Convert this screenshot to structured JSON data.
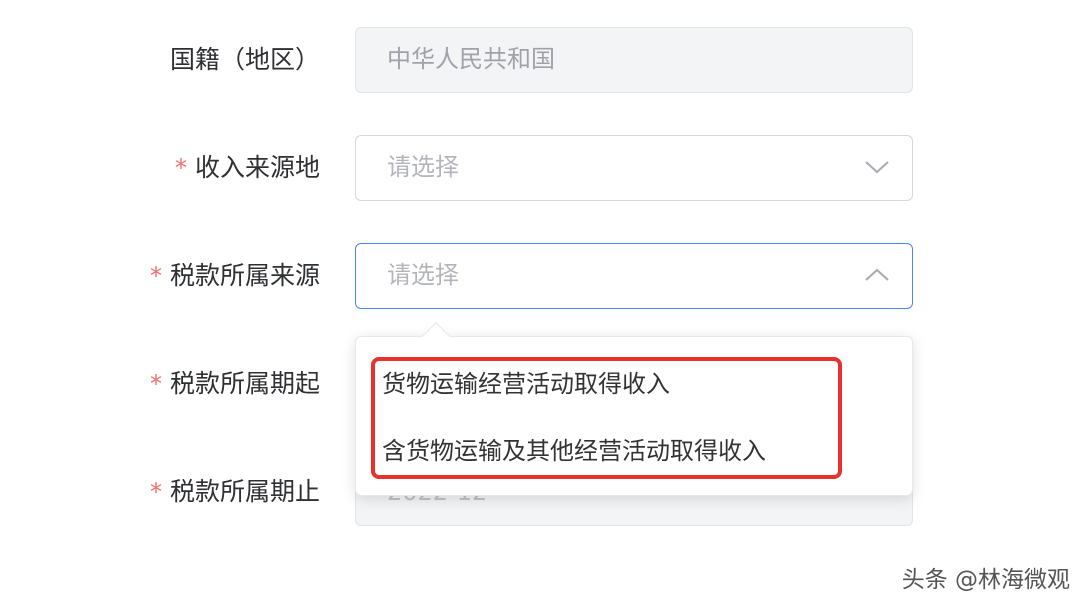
{
  "form": {
    "nationality": {
      "label": "国籍（地区）",
      "value": "中华人民共和国"
    },
    "income_source_place": {
      "required_mark": "*",
      "label": "收入来源地",
      "placeholder": "请选择"
    },
    "tax_source": {
      "required_mark": "*",
      "label": "税款所属来源",
      "placeholder": "请选择",
      "options": [
        "货物运输经营活动取得收入",
        "含货物运输及其他经营活动取得收入"
      ]
    },
    "period_start": {
      "required_mark": "*",
      "label": "税款所属期起"
    },
    "period_end": {
      "required_mark": "*",
      "label": "税款所属期止",
      "value_partial": "2022-12"
    }
  },
  "watermark": "头条 @林海微观",
  "colors": {
    "required": "#f56c6c",
    "focus_border": "#4b86f0",
    "highlight": "#e8302c"
  }
}
